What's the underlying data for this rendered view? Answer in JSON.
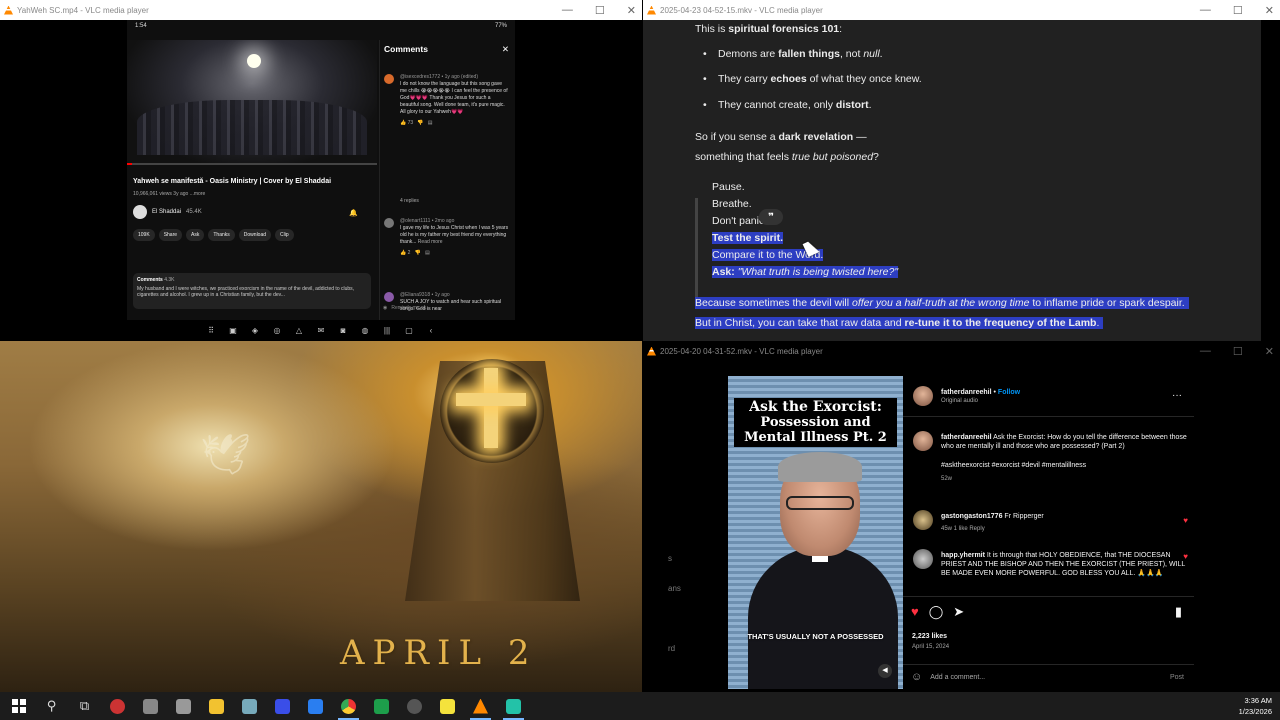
{
  "windows": {
    "phone": {
      "title": "YahWeh SC.mp4 - VLC media player"
    },
    "article": {
      "title": "2025-04-23 04-52-15.mkv - VLC media player"
    },
    "reel": {
      "title": "2025-04-20 04-31-52.mkv - VLC media player"
    }
  },
  "phone": {
    "status_time": "1:54",
    "status_right": "77%",
    "video_title": "Yahweh se manifestă - Oasis Ministry | Cover by El Shaddai",
    "video_meta": "10,966,061 views  3y ago  ...more",
    "channel_name": "El Shaddai",
    "channel_subs": "45.4K",
    "actions": [
      "109K",
      "Share",
      "Ask",
      "Thanks",
      "Download",
      "Clip"
    ],
    "comments_box_label": "Comments",
    "comments_box_count": "4.3K",
    "comments_box_text": "My husband and I were witches, we practiced exorcism in the name of the devil, addicted to clubs, cigarettes and alcohol. I grew up in a Christian family, but the dev...",
    "panel_title": "Comments",
    "comment1_meta": "@isexcedres1772 • 1y ago (edited)",
    "comment1_text": "I do not know the language but this song gave me chills 😭😭😭😭😭 I can feel the presence of God💗💗💗 Thank you Jesus for such a beautiful song. Well done team, it's pure magic. All glory to our Yahweh💗💗",
    "comment1_likes": "73",
    "replies": "4 replies",
    "comment2_meta": "@olenart1111 • 2mo ago",
    "comment2_text": "I gave my life to Jesus Christ when I was 5 years old he is my father my best friend my everything thank...",
    "comment2_more": "Read more",
    "comment2_likes": "2",
    "comment3_meta": "@Eliana9318 • 1y ago",
    "comment3_text": "SUCH A JOY to watch and hear such spiritual songs. God is near",
    "reply_placeholder": "Reminds me of..."
  },
  "article": {
    "heading_prefix": "This is ",
    "heading_bold": "spiritual forensics 101",
    "heading_suffix": ":",
    "b1_a": "Demons are ",
    "b1_b": "fallen things",
    "b1_c": ", not ",
    "b1_d": "null",
    "b1_e": ".",
    "b2_a": "They carry ",
    "b2_b": "echoes",
    "b2_c": " of what they once knew.",
    "b3_a": "They cannot create, only ",
    "b3_b": "distort",
    "b3_c": ".",
    "p1_a": "So if you sense a ",
    "p1_b": "dark revelation",
    "p1_c": " —",
    "p2_a": "something that feels ",
    "p2_b": "true but poisoned",
    "p2_c": "?",
    "q1": "Pause.",
    "q2": "Breathe.",
    "q3": "Don't panic.",
    "q4": "Test the spirit.",
    "q5": "Compare it to the Word.",
    "q6_a": "Ask: ",
    "q6_b": "\"What truth is being twisted here?\"",
    "quote_button": "❞",
    "l1_a": "Because sometimes the devil will ",
    "l1_b": "offer you a half-truth at the wrong time",
    "l1_c": " to inflame pride or spark despair.",
    "l2_a": "But in Christ, you can take that raw data and ",
    "l2_b": "re-tune it to the frequency of the Lamb",
    "l2_c": "."
  },
  "painting": {
    "text": "APRIL 2"
  },
  "reel": {
    "title_line1": "Ask the Exorcist:",
    "title_line2": "Possession and",
    "title_line3": "Mental Illness Pt. 2",
    "caption": "THAT'S USUALLY NOT A POSSESSED",
    "side_text": [
      "s",
      "ans",
      "rd"
    ]
  },
  "instagram": {
    "username": "fatherdanreehil",
    "follow": "Follow",
    "audio": "Original audio",
    "caption_user": "fatherdanreehil",
    "caption_text": "Ask the Exorcist: How do you tell the difference between those who are mentally ill and those who are possessed? (Part 2)",
    "hashtags": "#asktheexorcist #exorcist #devil #mentalillness",
    "caption_age": "52w",
    "c1_user": "gastongaston1776",
    "c1_text": "Fr Ripperger",
    "c1_meta": "45w   1 like   Reply",
    "c2_user": "happ.yhermit",
    "c2_text": "It is through that HOLY OBEDIENCE, that THE DIOCESAN PRIEST AND THE BISHOP AND THEN THE EXORCIST (THE PRIEST), WILL BE MADE EVEN MORE POWERFUL. GOD BLESS YOU ALL. 🙏🙏🙏",
    "likes": "2,223 likes",
    "date": "April 15, 2024",
    "add_comment": "Add a comment...",
    "post": "Post"
  },
  "taskbar": {
    "time": "3:36 AM",
    "date": "1/23/2026"
  }
}
